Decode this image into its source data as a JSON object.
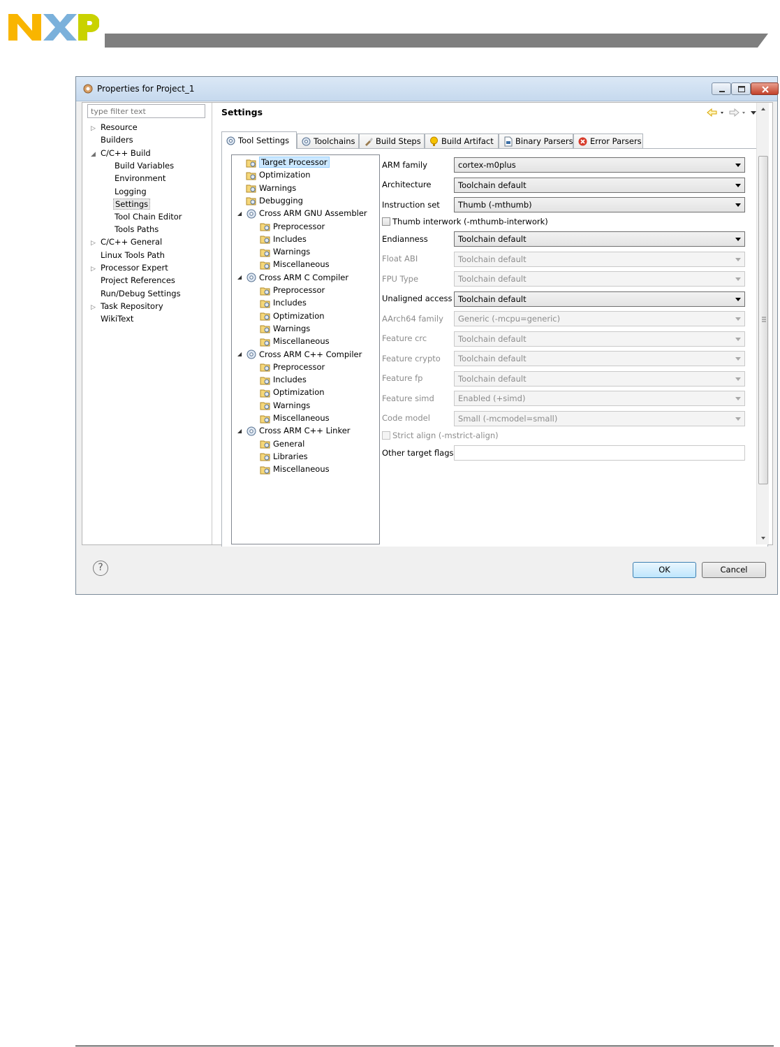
{
  "window": {
    "title": "Properties for Project_1"
  },
  "nav": {
    "filter_placeholder": "type filter text",
    "items": [
      {
        "label": "Resource"
      },
      {
        "label": "Builders"
      },
      {
        "label": "C/C++ Build"
      },
      {
        "label": "Build Variables"
      },
      {
        "label": "Environment"
      },
      {
        "label": "Logging"
      },
      {
        "label": "Settings"
      },
      {
        "label": "Tool Chain Editor"
      },
      {
        "label": "Tools Paths"
      },
      {
        "label": "C/C++ General"
      },
      {
        "label": "Linux Tools Path"
      },
      {
        "label": "Processor Expert"
      },
      {
        "label": "Project References"
      },
      {
        "label": "Run/Debug Settings"
      },
      {
        "label": "Task Repository"
      },
      {
        "label": "WikiText"
      }
    ]
  },
  "pane": {
    "title": "Settings"
  },
  "tabs": [
    {
      "label": "Tool Settings"
    },
    {
      "label": "Toolchains"
    },
    {
      "label": "Build Steps"
    },
    {
      "label": "Build Artifact"
    },
    {
      "label": "Binary Parsers"
    },
    {
      "label": "Error Parsers"
    }
  ],
  "tool_tree": [
    {
      "label": "Target Processor"
    },
    {
      "label": "Optimization"
    },
    {
      "label": "Warnings"
    },
    {
      "label": "Debugging"
    },
    {
      "label": "Cross ARM GNU Assembler"
    },
    {
      "label": "Preprocessor"
    },
    {
      "label": "Includes"
    },
    {
      "label": "Warnings"
    },
    {
      "label": "Miscellaneous"
    },
    {
      "label": "Cross ARM C Compiler"
    },
    {
      "label": "Preprocessor"
    },
    {
      "label": "Includes"
    },
    {
      "label": "Optimization"
    },
    {
      "label": "Warnings"
    },
    {
      "label": "Miscellaneous"
    },
    {
      "label": "Cross ARM C++ Compiler"
    },
    {
      "label": "Preprocessor"
    },
    {
      "label": "Includes"
    },
    {
      "label": "Optimization"
    },
    {
      "label": "Warnings"
    },
    {
      "label": "Miscellaneous"
    },
    {
      "label": "Cross ARM C++ Linker"
    },
    {
      "label": "General"
    },
    {
      "label": "Libraries"
    },
    {
      "label": "Miscellaneous"
    }
  ],
  "options": {
    "arm_family": {
      "label": "ARM family",
      "value": "cortex-m0plus"
    },
    "architecture": {
      "label": "Architecture",
      "value": "Toolchain default"
    },
    "instruction_set": {
      "label": "Instruction set",
      "value": "Thumb (-mthumb)"
    },
    "thumb_interwork": {
      "label": "Thumb interwork (-mthumb-interwork)"
    },
    "endianness": {
      "label": "Endianness",
      "value": "Toolchain default"
    },
    "float_abi": {
      "label": "Float ABI",
      "value": "Toolchain default"
    },
    "fpu_type": {
      "label": "FPU Type",
      "value": "Toolchain default"
    },
    "unaligned_access": {
      "label": "Unaligned access",
      "value": "Toolchain default"
    },
    "aarch64_family": {
      "label": "AArch64 family",
      "value": "Generic (-mcpu=generic)"
    },
    "feature_crc": {
      "label": "Feature crc",
      "value": "Toolchain default"
    },
    "feature_crypto": {
      "label": "Feature crypto",
      "value": "Toolchain default"
    },
    "feature_fp": {
      "label": "Feature fp",
      "value": "Toolchain default"
    },
    "feature_simd": {
      "label": "Feature simd",
      "value": "Enabled (+simd)"
    },
    "code_model": {
      "label": "Code model",
      "value": "Small (-mcmodel=small)"
    },
    "strict_align": {
      "label": "Strict align (-mstrict-align)"
    },
    "other_target_flags": {
      "label": "Other target flags",
      "value": ""
    }
  },
  "buttons": {
    "ok": "OK",
    "cancel": "Cancel"
  },
  "colors": {
    "nxp_yellow": "#f9b500",
    "nxp_blue": "#7bb1db",
    "nxp_green": "#c9d200",
    "header_bar": "#7f7f7f"
  }
}
